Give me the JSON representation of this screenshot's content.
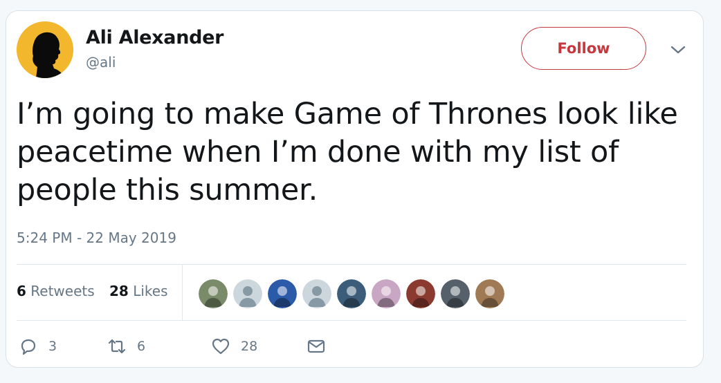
{
  "tweet": {
    "author": {
      "display_name": "Ali Alexander",
      "handle": "@ali",
      "avatar": "silhouette-profile-avatar",
      "avatar_color": "#f3b72e"
    },
    "follow_label": "Follow",
    "menu_icon": "chevron-down-icon",
    "text": "I’m going to make Game of Thrones look like peacetime when I’m done with my list of people this summer.",
    "timestamp": "5:24 PM - 22 May 2019"
  },
  "stats": {
    "retweets_count": "6",
    "retweets_label": "Retweets",
    "likes_count": "28",
    "likes_label": "Likes"
  },
  "likers": [
    {
      "name": "liker-avatar-1",
      "color": "#7a8b6a"
    },
    {
      "name": "liker-avatar-2",
      "color": "#ccd6dd"
    },
    {
      "name": "liker-avatar-3",
      "color": "#2b5aa8"
    },
    {
      "name": "liker-avatar-4",
      "color": "#ccd6dd"
    },
    {
      "name": "liker-avatar-5",
      "color": "#3c5d7a"
    },
    {
      "name": "liker-avatar-6",
      "color": "#c9a7c4"
    },
    {
      "name": "liker-avatar-7",
      "color": "#8a3a2e"
    },
    {
      "name": "liker-avatar-8",
      "color": "#55606b"
    },
    {
      "name": "liker-avatar-9",
      "color": "#a07a55"
    }
  ],
  "actions": {
    "reply_count": "3",
    "retweet_count": "6",
    "like_count": "28"
  },
  "colors": {
    "accent": "#c7373d",
    "muted": "#657786",
    "text": "#14171a"
  }
}
